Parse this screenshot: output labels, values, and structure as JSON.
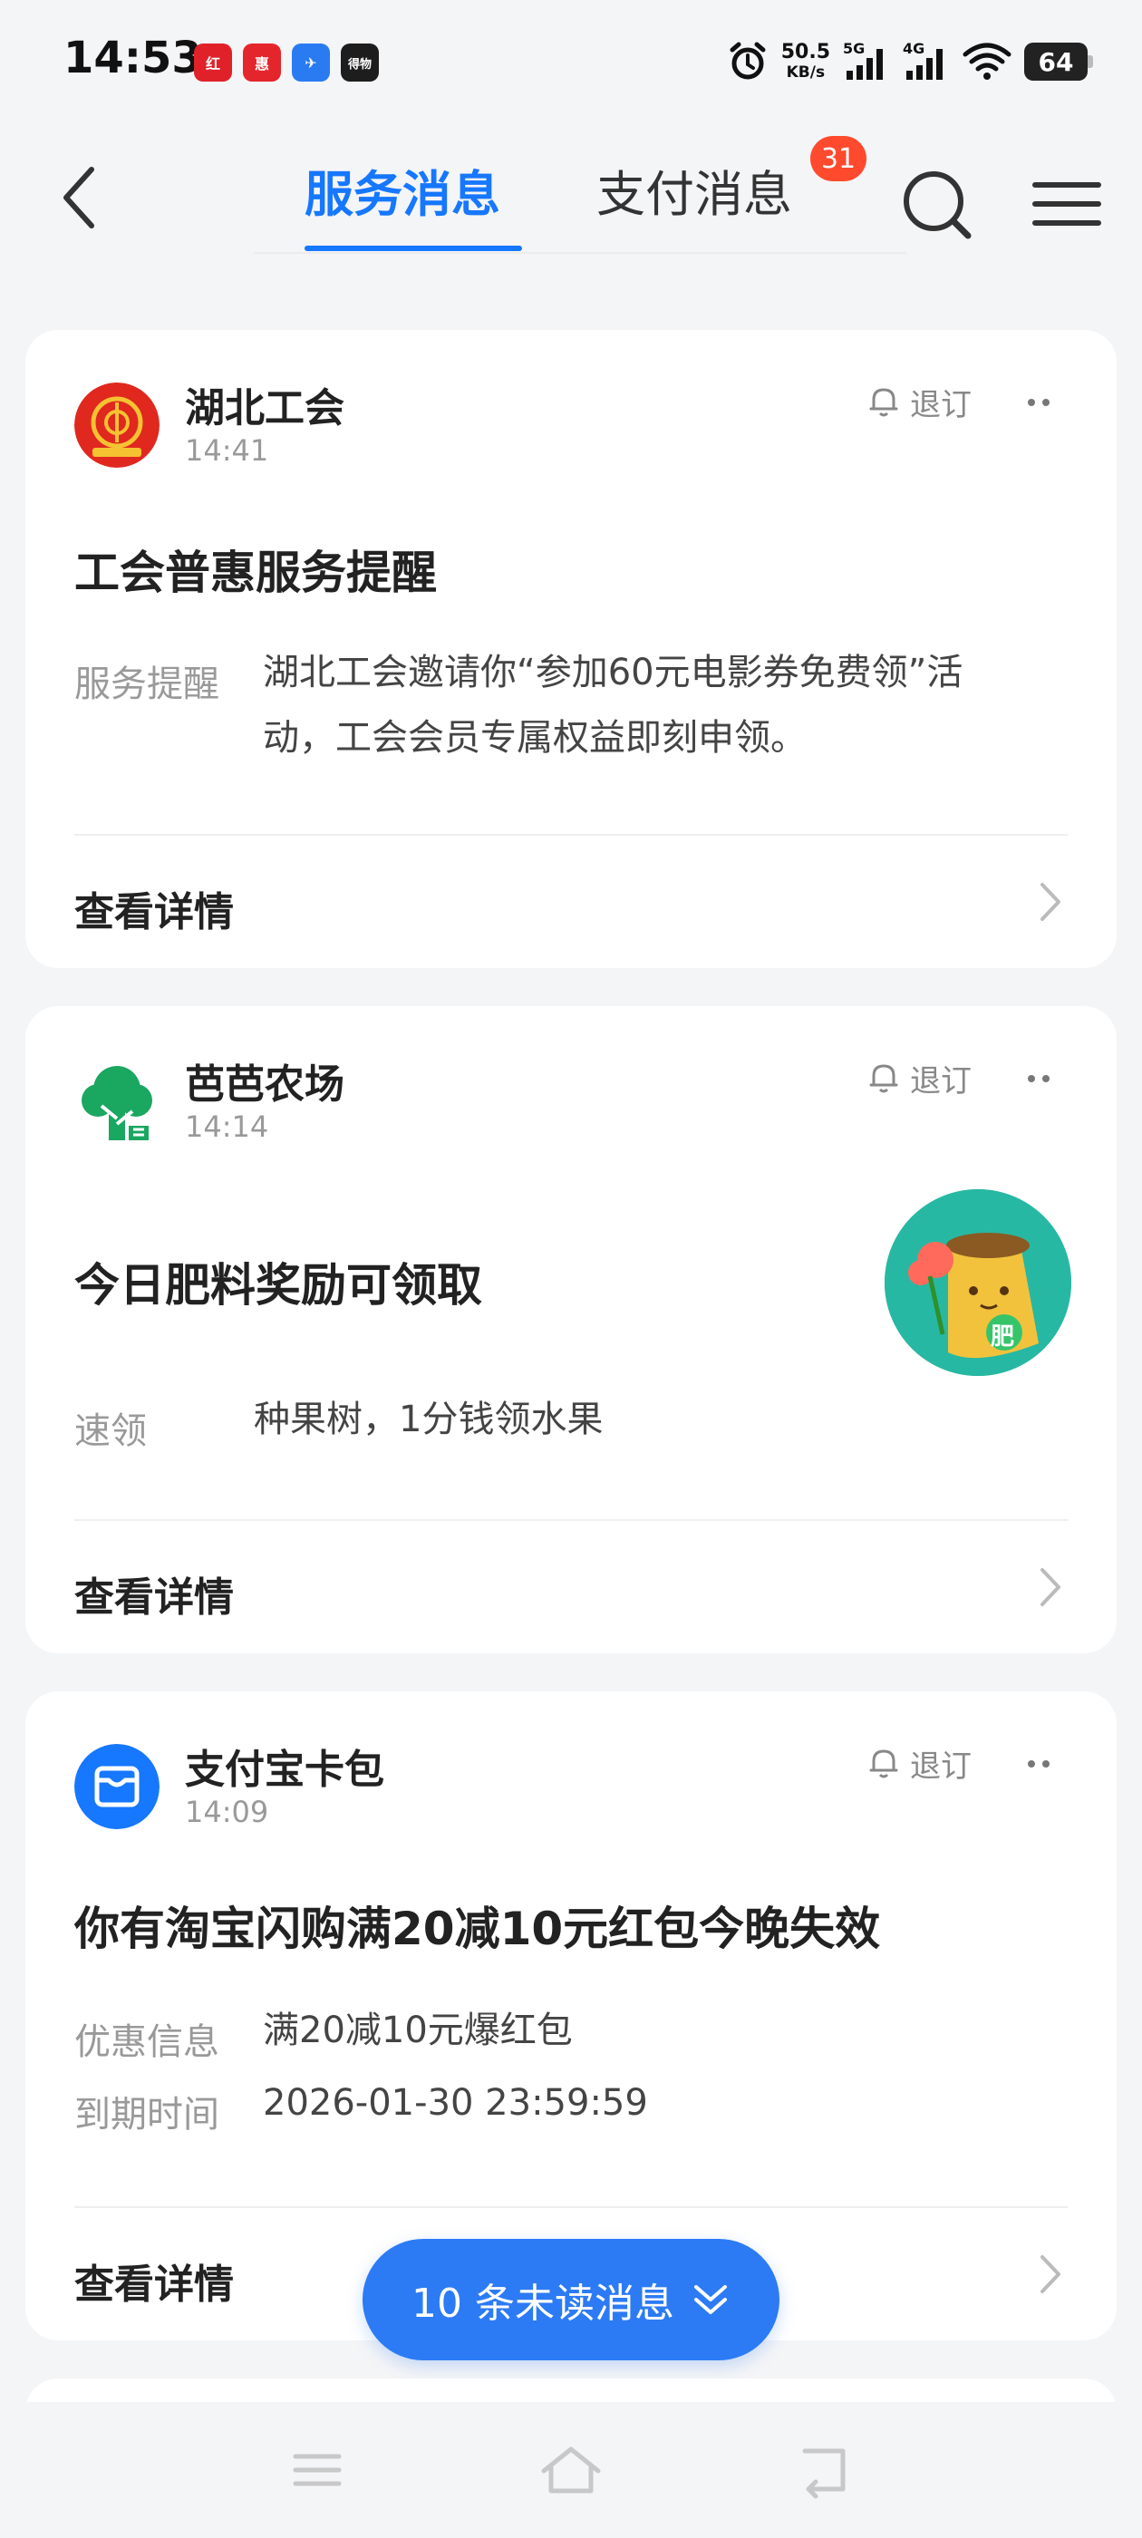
{
  "status_bar": {
    "time": "14:53",
    "app_icons": [
      "红",
      "惠",
      "✈",
      "得物"
    ],
    "net_speed_value": "50.5",
    "net_speed_unit": "KB/s",
    "signal_1_label": "5G",
    "signal_2_label": "4G",
    "battery": "64"
  },
  "header": {
    "tab_service": "服务消息",
    "tab_pay": "支付消息",
    "pay_badge": "31",
    "accent_color": "#1677ff"
  },
  "cards": [
    {
      "source": "湖北工会",
      "time": "14:41",
      "unsubscribe": "退订",
      "title": "工会普惠服务提醒",
      "rows": [
        {
          "label": "服务提醒",
          "lines": [
            "湖北工会邀请你“参加60元电影券免费领”活",
            "动，工会会员专属权益即刻申领。"
          ]
        }
      ],
      "detail": "查看详情"
    },
    {
      "source": "芭芭农场",
      "time": "14:14",
      "unsubscribe": "退订",
      "title": "今日肥料奖励可领取",
      "rows": [
        {
          "label": "速领",
          "value": "种果树，1分钱领水果"
        }
      ],
      "image_text": "肥",
      "detail": "查看详情"
    },
    {
      "source": "支付宝卡包",
      "time": "14:09",
      "unsubscribe": "退订",
      "title": "你有淘宝闪购满20减10元红包今晚失效",
      "rows": [
        {
          "label": "优惠信息",
          "value": "满20减10元爆红包"
        },
        {
          "label": "到期时间",
          "value": "2026-01-30 23:59:59"
        }
      ],
      "detail": "查看详情"
    }
  ],
  "unread_button": {
    "label": "10 条未读消息"
  }
}
